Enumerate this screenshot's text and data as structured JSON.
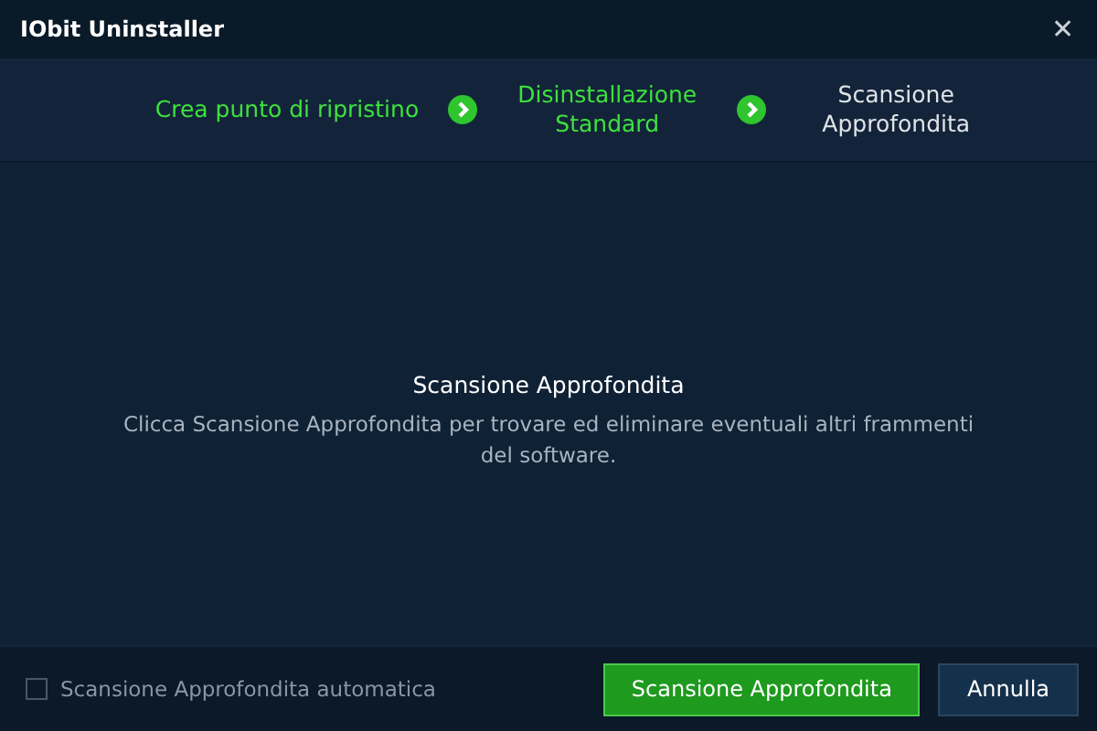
{
  "window": {
    "title": "IObit Uninstaller",
    "close": "✕"
  },
  "steps": [
    {
      "label": "Crea punto di ripristino",
      "done": true
    },
    {
      "label": "Disinstallazione Standard",
      "done": true
    },
    {
      "label": "Scansione Approfondita",
      "done": false
    }
  ],
  "content": {
    "heading": "Scansione Approfondita",
    "description": "Clicca Scansione Approfondita per trovare ed eliminare eventuali altri frammenti del software."
  },
  "footer": {
    "checkbox": {
      "label": "Scansione Approfondita automatica",
      "checked": false
    },
    "primary_button": "Scansione Approfondita",
    "cancel_button": "Annulla"
  }
}
